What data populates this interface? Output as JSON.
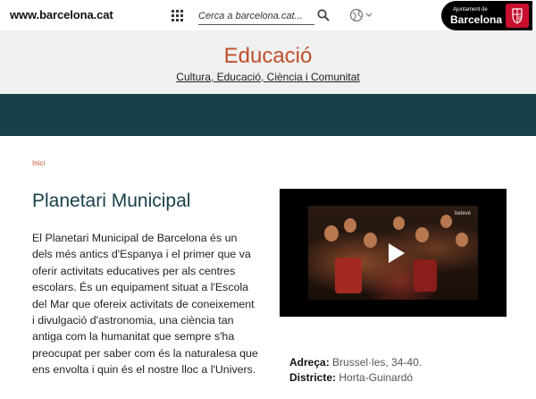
{
  "topbar": {
    "site": "www.barcelona.cat",
    "search_placeholder": "Cerca a barcelona.cat...",
    "logo_small": "Ajuntament de",
    "logo_big": "Barcelona"
  },
  "header": {
    "title": "Educació",
    "subtitle": "Cultura, Educació, Ciència i Comunitat"
  },
  "breadcrumb": "Inici",
  "page": {
    "title": "Planetari Municipal",
    "intro": "El Planetari Municipal de Barcelona és un dels més antics d'Espanya i el primer que va oferir activitats educatives per als centres escolars. És un equipament situat a l'Escola del Mar que ofereix activitats de coneixement i divulgació d'astronomia, una ciència tan antiga com la humanitat que sempre s'ha preocupat per saber com és la naturalesa que ens envolta i quin és el nostre lloc a l'Univers."
  },
  "video": {
    "channel": "betevé"
  },
  "info": {
    "address_label": "Adreça:",
    "address_value": "Brussel·les, 34-40.",
    "district_label": "Districte:",
    "district_value": "Horta-Guinardó"
  },
  "colors": {
    "accent": "#c0502c",
    "teal": "#173f47",
    "brand_red": "#c8102e"
  }
}
